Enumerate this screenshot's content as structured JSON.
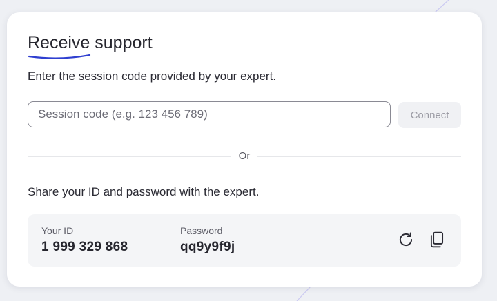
{
  "header": {
    "title": "Receive support",
    "accent_color": "#2f3fd0"
  },
  "session": {
    "instructions": "Enter the session code provided by your expert.",
    "input_value": "",
    "input_placeholder": "Session code (e.g. 123 456 789)",
    "connect_label": "Connect"
  },
  "divider": {
    "label": "Or"
  },
  "share": {
    "instructions": "Share your ID and password with the expert.",
    "id_label": "Your ID",
    "id_value": "1 999 329 868",
    "password_label": "Password",
    "password_value": "qq9y9f9j",
    "icons": [
      "refresh-icon",
      "copy-icon"
    ]
  }
}
